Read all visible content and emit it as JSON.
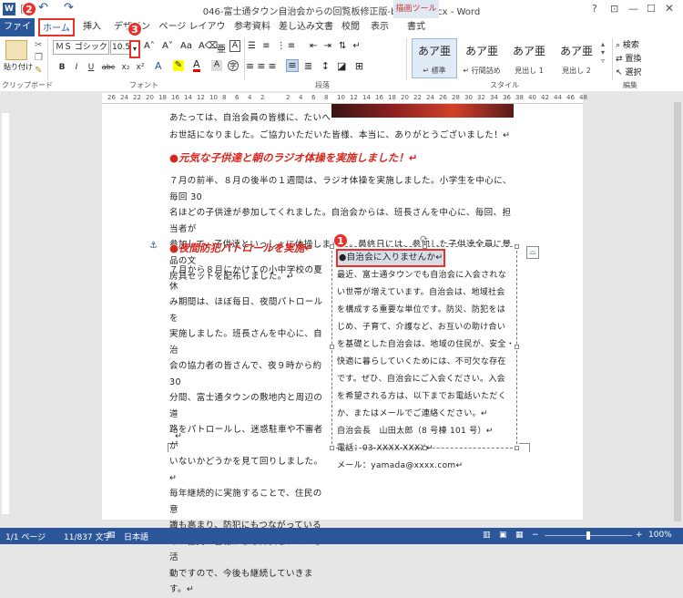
{
  "window": {
    "title": "046-富士通タウン自治会からの回覧板修正版-beforer.docx - Word",
    "tool_tab_group": "描画ツール",
    "app_letter": "W"
  },
  "tabs": [
    "ファイル",
    "ホーム",
    "挿入",
    "デザイン",
    "ページ レイアウト",
    "参考資料",
    "差し込み文書",
    "校閲",
    "表示",
    "書式"
  ],
  "ribbon": {
    "paste_label": "貼り付け",
    "font_name": "ＭＳ ゴシック (",
    "font_size": "10.5",
    "groups": [
      "クリップボード",
      "フォント",
      "段落",
      "スタイル",
      "編集"
    ],
    "styles": [
      {
        "sample": "あア亜",
        "name": "↵ 標準"
      },
      {
        "sample": "あア亜",
        "name": "↵ 行間詰め"
      },
      {
        "sample": "あア亜",
        "name": "見出し 1"
      },
      {
        "sample": "あア亜",
        "name": "見出し 2"
      }
    ],
    "edit": [
      "検索",
      "置換",
      "選択"
    ],
    "font_buttons": [
      "B",
      "I",
      "U",
      "abc",
      "x₂",
      "x²",
      "A"
    ]
  },
  "ruler_ticks": [
    "26",
    "24",
    "22",
    "20",
    "18",
    "16",
    "14",
    "12",
    "10",
    "8",
    "6",
    "4",
    "2",
    "",
    "2",
    "4",
    "6",
    "8",
    "10",
    "12",
    "14",
    "16",
    "18",
    "20",
    "22",
    "24",
    "26",
    "28",
    "30",
    "32",
    "34",
    "36",
    "38",
    "40",
    "42",
    "44",
    "46",
    "48"
  ],
  "document": {
    "intro_lines": [
      "あたっては、自治会員の皆様に、たいへ",
      "お世話になりました。ご協力いただいた皆様、本当に、ありがとうございました！↵"
    ],
    "heading1": "●元気な子供達と朝のラジオ体操を実施しました！↵",
    "para1": [
      "７月の前半、８月の後半の１週間は、ラジオ体操を実施しました。小学生を中心に、毎回 30",
      "名ほどの子供達が参加してくれました。自治会からは、班長さんを中心に、毎回、担当者が",
      "参加して、子供達といっしょに体操しました。最終日には、参加した子供達全員に景品の文",
      "房具セットを配布しました。↵"
    ],
    "heading2": "●夜間防犯パトロールを実施↵",
    "para2": [
      "７月から８月にかけての小中学校の夏休",
      "み期間は、ほぼ毎日、夜間パトロールを",
      "実施しました。班長さんを中心に、自治",
      "会の協力者の皆さんで、夜９時から約 30",
      "分間、富士通タウンの敷地内と周辺の道",
      "路をパトロールし、迷惑駐車や不審者が",
      "いないかどうかを見て回りしました。↵",
      "毎年継続的に実施することで、住民の意",
      "識も高まり、防犯にもつながっている",
      "と、住民の皆様からも評価されている活",
      "動ですので、今後も継続していきます。↵"
    ],
    "textbox": {
      "title": "●自治会に入りませんか↵",
      "lines": [
        "最近、富士通タウンでも自治会に入会されな",
        "い世帯が増えています。自治会は、地域社会",
        "を構成する重要な単位です。防災、防犯をは",
        "じめ、子育て、介護など、お互いの助け合い",
        "を基礎とした自治会は、地域の住民が、安全・",
        "快適に暮らしていくためには、不可欠な存在",
        "です。ぜひ、自治会にご入会ください。入会",
        "を希望される方は、以下までお電話いただく",
        "か、またはメールでご連絡ください。↵",
        "自治会長　山田太郎（8 号棟 101 号）↵",
        "電話：03-XXXX-XXXX↵",
        "メール：yamada@xxxx.com↵"
      ]
    },
    "after_para": "↵"
  },
  "badges": [
    "1",
    "2",
    "3"
  ],
  "status": {
    "page": "1/1 ページ",
    "words": "11/837 文字",
    "language": "日本語",
    "zoom": "100%"
  },
  "colors": {
    "accent": "#2b579a",
    "callout": "#e8312b",
    "heading": "#d7261e"
  }
}
